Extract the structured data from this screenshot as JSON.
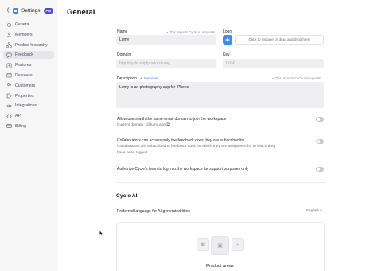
{
  "sidebar": {
    "app_title": "Settings",
    "badge": "Pro",
    "items": [
      {
        "label": "General",
        "icon": "settings-icon",
        "active": false
      },
      {
        "label": "Members",
        "icon": "members-icon",
        "active": false
      },
      {
        "label": "Product hierarchy",
        "icon": "hierarchy-icon",
        "active": false
      },
      {
        "label": "Feedback",
        "icon": "feedback-icon",
        "active": true
      },
      {
        "label": "Features",
        "icon": "features-icon",
        "active": false
      },
      {
        "label": "Releases",
        "icon": "releases-icon",
        "active": false
      },
      {
        "label": "Customers",
        "icon": "customers-icon",
        "active": false
      },
      {
        "label": "Properties",
        "icon": "properties-icon",
        "active": false
      },
      {
        "label": "Integrations",
        "icon": "integrations-icon",
        "active": false
      },
      {
        "label": "API",
        "icon": "api-icon",
        "active": false
      },
      {
        "label": "Billing",
        "icon": "billing-icon",
        "active": false
      }
    ]
  },
  "page": {
    "title": "General"
  },
  "form": {
    "name": {
      "label": "Name",
      "hint": "This impacts Cycle AI requests",
      "value": "Lumy"
    },
    "logo": {
      "label": "Logo",
      "dropzone": "Click to replace or drag and drop here"
    },
    "domain": {
      "label": "Domain",
      "placeholder": "http://cycle.app/product/lumy"
    },
    "key": {
      "label": "Key",
      "placeholder": "LUM"
    },
    "description": {
      "label": "Description",
      "generate": "Generate",
      "hint": "This impacts Cycle AI requests",
      "value": "Lumy is an photography app for iPhone"
    }
  },
  "toggles": [
    {
      "title": "Allow users with the same email domain to join the workspace",
      "subtitle": "Current domain : @lumy.app",
      "on": false
    },
    {
      "title": "Collaborators can access only the feedback docs they are subscribed to",
      "subtitle": "Collaborators are subscribed to feedback docs for which they are assignee of or in which they have been tagged",
      "on": false
    },
    {
      "title": "Authorize Cycle's team to log into the workspace for support purposes only",
      "subtitle": "",
      "on": false
    }
  ],
  "cycle_ai": {
    "section_title": "Cycle AI",
    "pref_label": "Preferred language for AI-generated titles",
    "pref_value": "English"
  },
  "product_areas": {
    "label": "Product areas"
  },
  "colors": {
    "accent": "#3b82f6",
    "badge": "#4f46e5",
    "logo_tile": "#3b8cf0"
  }
}
